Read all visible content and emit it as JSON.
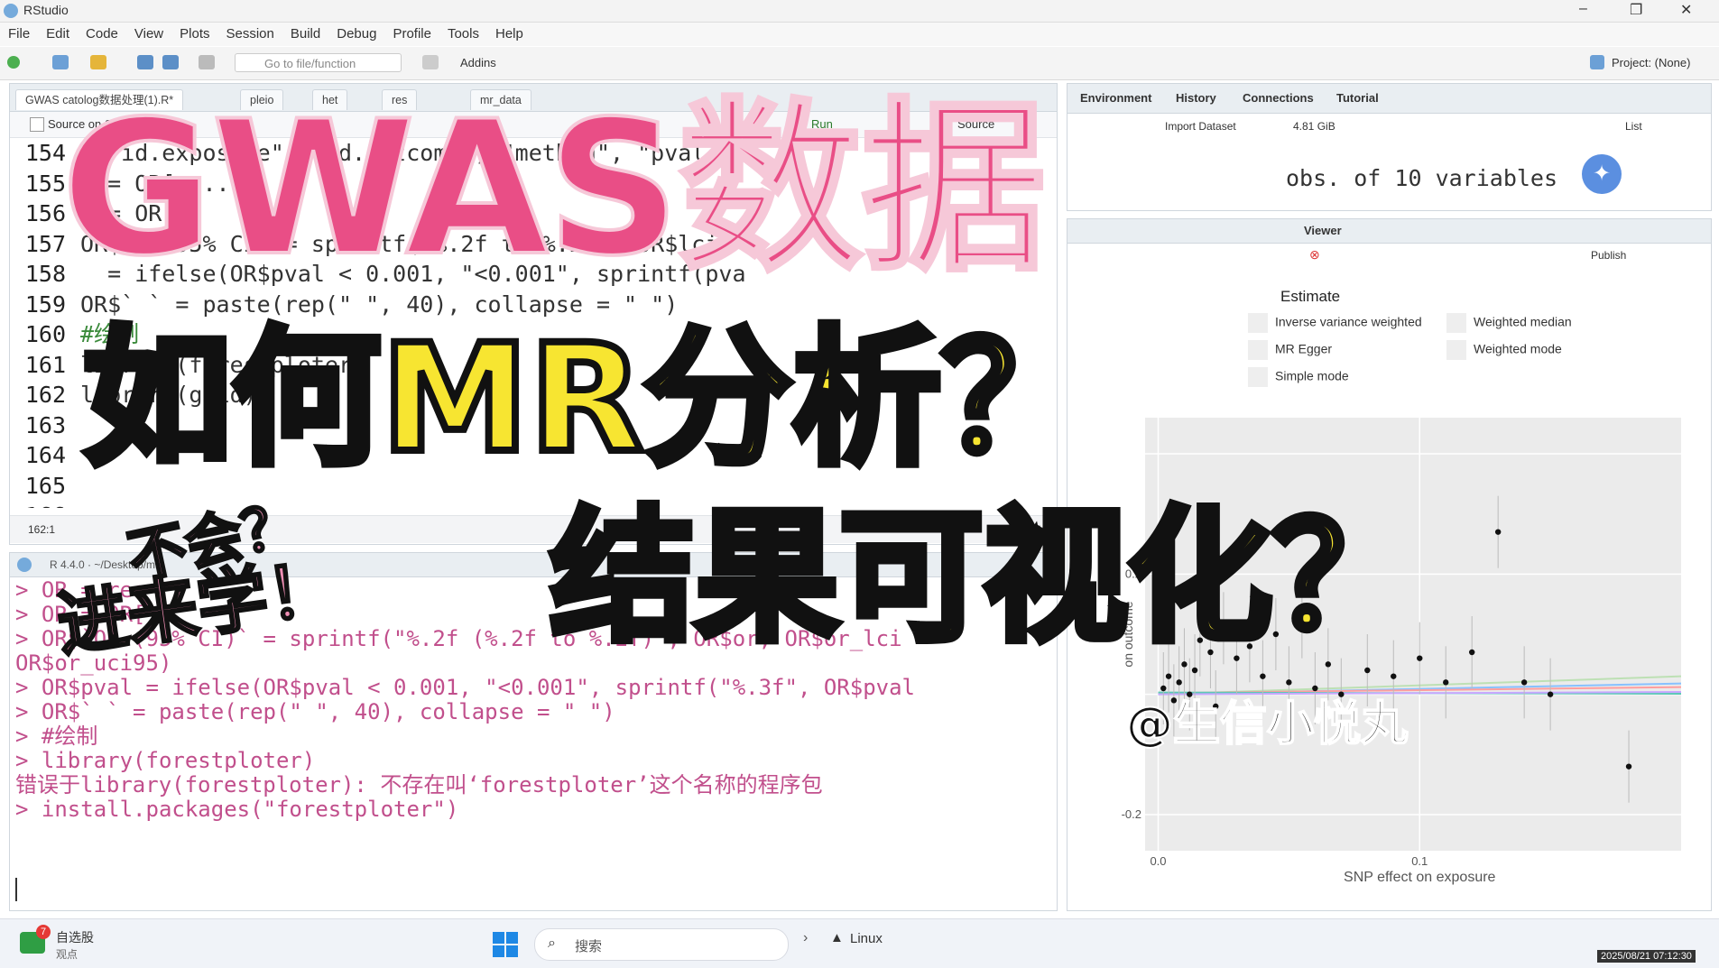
{
  "window": {
    "title": "RStudio",
    "controls": {
      "minimize": "–",
      "maximize": "❐",
      "close": "✕"
    }
  },
  "menu": [
    "File",
    "Edit",
    "Code",
    "View",
    "Plots",
    "Session",
    "Build",
    "Debug",
    "Profile",
    "Tools",
    "Help"
  ],
  "toolbar": {
    "goto_placeholder": "Go to file/function",
    "addins": "Addins",
    "project": "Project: (None)"
  },
  "editor": {
    "tabs": [
      "GWAS catolog数据处理(1).R*",
      "pleio",
      "het",
      "res",
      "mr_data"
    ],
    "source_on_save": "Source on Save",
    "run": "Run",
    "source": "Source",
    "lines": [
      {
        "n": "154",
        "text": "c(\"id.exposure\", \"id.outcome\", \"method\", \"pval"
      },
      {
        "n": "155",
        "text": "  = OR[ ..."
      },
      {
        "n": "156",
        "text": "  = OR co"
      },
      {
        "n": "157",
        "text": "OR$`OR 95% CI` = sprintf(\"%.2f to %.2f\", OR$lci"
      },
      {
        "n": "158",
        "text": "  = ifelse(OR$pval < 0.001, \"<0.001\", sprintf(pva"
      },
      {
        "n": "159",
        "text": "OR$` ` = paste(rep(\" \", 40), collapse = \" \")"
      },
      {
        "n": "160",
        "text": "#绘制"
      },
      {
        "n": "161",
        "text": "library(forestploter)"
      },
      {
        "n": "162",
        "text": "library(grid)"
      },
      {
        "n": "163",
        "text": ""
      },
      {
        "n": "164",
        "text": ""
      },
      {
        "n": "165",
        "text": ""
      },
      {
        "n": "166",
        "text": ""
      }
    ],
    "status_pos": "162:1",
    "status_type": "R Script"
  },
  "console": {
    "header": "R 4.4.0 · ~/Desktop/mr/",
    "lines": [
      "> OR = res",
      "> OR = OR[ ]",
      "> OR$`OR (95% CI)` = sprintf(\"%.2f (%.2f to %.2f)\", OR$or, OR$or_lci",
      "OR$or_uci95)",
      "> OR$pval = ifelse(OR$pval < 0.001, \"<0.001\", sprintf(\"%.3f\", OR$pval",
      "> OR$` ` = paste(rep(\" \", 40), collapse = \" \")",
      "> #绘制",
      "> library(forestploter)",
      "错误于library(forestploter): 不存在叫‘forestploter’这个名称的程序包",
      "> install.packages(\"forestploter\")"
    ]
  },
  "env": {
    "tabs": [
      "Environment",
      "History",
      "Connections",
      "Tutorial"
    ],
    "import": "Import Dataset",
    "memory": "4.81 GiB",
    "list": "List",
    "summary": "obs. of 10 variables"
  },
  "viewer": {
    "tabs": [
      "Viewer"
    ],
    "publish": "Publish",
    "legend_title": "Estimate",
    "legend": [
      "Inverse variance weighted",
      "Weighted median",
      "MR Egger",
      "Weighted mode",
      "Simple mode"
    ],
    "y_ticks": [
      "0.2",
      "-0.2"
    ],
    "x_ticks": [
      "0.0",
      "0.1"
    ],
    "xlabel": "SNP effect on exposure",
    "ylabel": "on outcome"
  },
  "overlays": {
    "title": "GWAS数据",
    "q1": "如何MR分析？",
    "q2": "结果可视化？",
    "s1": "不会？",
    "s2": "进来学！",
    "watermark": "@生信小悦丸"
  },
  "taskbar": {
    "stock_name": "自选股",
    "stock_sub": "观点",
    "badge": "7",
    "search": "搜索",
    "linux": "Linux",
    "clock": "2025/08/21 07:12:30"
  },
  "colors": {
    "pink": "#e94e86",
    "yellow": "#f7e531",
    "r_blue": "#75aadb"
  },
  "chart_data": {
    "type": "scatter",
    "xlabel": "SNP effect on exposure",
    "ylabel": "on outcome",
    "xlim": [
      -0.005,
      0.2
    ],
    "ylim": [
      -0.26,
      0.46
    ],
    "series": [
      {
        "points": [
          [
            0.002,
            0.01
          ],
          [
            0.004,
            0.03
          ],
          [
            0.006,
            -0.01
          ],
          [
            0.008,
            0.02
          ],
          [
            0.01,
            0.05
          ],
          [
            0.012,
            0.0
          ],
          [
            0.014,
            0.04
          ],
          [
            0.016,
            0.09
          ],
          [
            0.02,
            0.07
          ],
          [
            0.022,
            -0.02
          ],
          [
            0.025,
            0.11
          ],
          [
            0.03,
            0.06
          ],
          [
            0.035,
            0.08
          ],
          [
            0.04,
            0.03
          ],
          [
            0.045,
            0.1
          ],
          [
            0.05,
            0.02
          ],
          [
            0.055,
            0.12
          ],
          [
            0.06,
            0.01
          ],
          [
            0.065,
            0.05
          ],
          [
            0.07,
            0.0
          ],
          [
            0.08,
            0.04
          ],
          [
            0.09,
            0.03
          ],
          [
            0.1,
            0.06
          ],
          [
            0.11,
            0.02
          ],
          [
            0.12,
            0.07
          ],
          [
            0.13,
            0.27
          ],
          [
            0.14,
            0.02
          ],
          [
            0.15,
            0.0
          ],
          [
            0.18,
            -0.12
          ]
        ]
      }
    ],
    "lines": [
      {
        "name": "Inverse variance weighted",
        "color": "#88c1ff",
        "slope": 0.09,
        "intercept": 0.0
      },
      {
        "name": "Weighted median",
        "color": "#bde0b4",
        "slope": 0.15,
        "intercept": 0.0
      },
      {
        "name": "MR Egger",
        "color": "#ff9e9e",
        "slope": 0.05,
        "intercept": 0.002
      },
      {
        "name": "Weighted mode",
        "color": "#5cc9b6",
        "slope": -0.01,
        "intercept": 0.003
      },
      {
        "name": "Simple mode",
        "color": "#c8a7ff",
        "slope": 0.02,
        "intercept": 0.0
      }
    ]
  }
}
